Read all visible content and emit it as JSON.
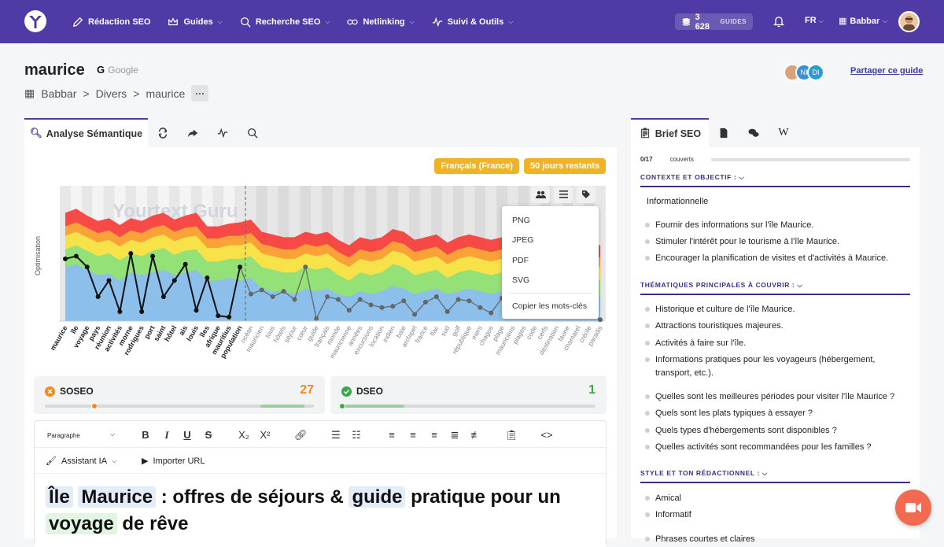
{
  "nav": {
    "items": [
      {
        "label": "Rédaction SEO",
        "caret": false
      },
      {
        "label": "Guides",
        "caret": true
      },
      {
        "label": "Recherche SEO",
        "caret": true
      },
      {
        "label": "Netlinking",
        "caret": true
      },
      {
        "label": "Suivi & Outils",
        "caret": true
      }
    ],
    "credits_value": "3 628",
    "credits_unit": "GUIDES",
    "lang": "FR",
    "account": "Babbar"
  },
  "header": {
    "title": "maurice",
    "engine": "Google",
    "engine_letter": "G",
    "breadcrumb": [
      "Babbar",
      "Divers",
      "maurice"
    ],
    "more": "···",
    "share": "Partager ce guide",
    "collaborators": [
      "NI",
      "DI"
    ]
  },
  "left": {
    "tab_active": "Analyse Sémantique",
    "badges": [
      "Français (France)",
      "50 jours restants"
    ]
  },
  "chart_data": {
    "type": "area",
    "title": "",
    "ylabel": "Optimisation",
    "watermark": "Yourtext.Guru",
    "categories": [
      "maurice",
      "île",
      "voyage",
      "pays",
      "réunion",
      "activités",
      "morne",
      "rodrigues",
      "port",
      "saint",
      "hôtel",
      "ais",
      "louis",
      "îles",
      "afrique",
      "mauritius",
      "population",
      "océan",
      "mauricien",
      "tous",
      "hôtels",
      "séjour",
      "cœur",
      "guide",
      "français",
      "monde",
      "mauricienne",
      "années",
      "excursions",
      "location",
      "indien",
      "baie",
      "archipel",
      "france",
      "flac",
      "sud",
      "golf",
      "république",
      "mers",
      "chagos",
      "plage",
      "mauriciens",
      "plages",
      "code",
      "cerfs",
      "destination",
      "faune",
      "chamarel",
      "créole",
      "paradis"
    ],
    "ylim": [
      0,
      100
    ],
    "split_index": 16,
    "series": [
      {
        "values": [
          46,
          48,
          40,
          18,
          30,
          7,
          50,
          7,
          48,
          18,
          30,
          42,
          8,
          32,
          4,
          3,
          40,
          20,
          23,
          18,
          22,
          16,
          40,
          2,
          18,
          16,
          8,
          16,
          12,
          10,
          11,
          15,
          5,
          14,
          18,
          7,
          16,
          15,
          10,
          6,
          17,
          6,
          18,
          8,
          12,
          10,
          5,
          14,
          8,
          1
        ]
      }
    ],
    "bands": {
      "blue": [
        40,
        42,
        38,
        34,
        35,
        30,
        36,
        34,
        36,
        38,
        34,
        36,
        38,
        30,
        30,
        32,
        30,
        32,
        24,
        22,
        22,
        20,
        24,
        22,
        24,
        20,
        18,
        22,
        20,
        22,
        26,
        24,
        20,
        22,
        24,
        20,
        22,
        24,
        22,
        20,
        22,
        24,
        26,
        22,
        22,
        22,
        22,
        22,
        20,
        18
      ],
      "green": [
        53,
        56,
        52,
        48,
        50,
        45,
        50,
        48,
        52,
        54,
        49,
        52,
        53,
        44,
        44,
        46,
        46,
        48,
        40,
        38,
        36,
        36,
        40,
        38,
        40,
        34,
        30,
        36,
        34,
        36,
        42,
        40,
        34,
        36,
        38,
        32,
        36,
        38,
        36,
        34,
        36,
        38,
        40,
        36,
        36,
        36,
        34,
        36,
        32,
        30
      ],
      "yellow": [
        63,
        66,
        62,
        58,
        60,
        55,
        60,
        58,
        62,
        64,
        59,
        62,
        63,
        54,
        54,
        56,
        56,
        58,
        50,
        48,
        46,
        46,
        50,
        48,
        50,
        44,
        40,
        46,
        44,
        46,
        52,
        50,
        44,
        46,
        48,
        42,
        46,
        48,
        46,
        44,
        46,
        48,
        50,
        46,
        46,
        46,
        44,
        46,
        42,
        40
      ],
      "orange": [
        70,
        73,
        69,
        65,
        67,
        62,
        67,
        65,
        69,
        71,
        66,
        69,
        70,
        61,
        61,
        63,
        63,
        65,
        57,
        55,
        53,
        53,
        57,
        55,
        57,
        51,
        47,
        53,
        51,
        53,
        59,
        57,
        51,
        53,
        55,
        49,
        53,
        55,
        53,
        51,
        53,
        55,
        57,
        53,
        53,
        53,
        51,
        53,
        49,
        47
      ],
      "red": [
        80,
        83,
        78,
        74,
        76,
        71,
        76,
        74,
        78,
        80,
        75,
        78,
        80,
        70,
        70,
        72,
        73,
        75,
        66,
        64,
        62,
        62,
        66,
        64,
        66,
        60,
        56,
        62,
        60,
        62,
        68,
        66,
        60,
        62,
        64,
        58,
        62,
        64,
        62,
        60,
        62,
        64,
        66,
        62,
        62,
        62,
        60,
        62,
        58,
        56
      ]
    },
    "colors": {
      "blue": "#8bbdf0",
      "green": "#8ee07a",
      "yellow": "#f8e64a",
      "orange": "#f9a738",
      "red": "#f8413e",
      "line": "#111111"
    }
  },
  "export_menu": [
    "PNG",
    "JPEG",
    "PDF",
    "SVG",
    "Copier les mots-clés"
  ],
  "scores": [
    {
      "label": "SOSEO",
      "value": "27",
      "color": "#f08a1c",
      "progress": 0.18
    },
    {
      "label": "DSEO",
      "value": "1",
      "color": "#3aa64a",
      "progress": 0.0
    }
  ],
  "toolbar": {
    "paragraph": "Paragraphe",
    "assistant": "Assistant IA",
    "import": "Importer URL"
  },
  "content": {
    "line1_parts": [
      "Île",
      "Maurice",
      " : offres de séjours & ",
      "guide",
      " pratique pour un"
    ],
    "line2_parts": [
      "voyage",
      " de rêve"
    ]
  },
  "right": {
    "tab_active": "Brief SEO",
    "progress_label": "0/17",
    "progress_suffix": "couverts",
    "section1": "CONTEXTE ET OBJECTIF :",
    "intent": "Informationnelle",
    "objectives": [
      "Fournir des informations sur l'île Maurice.",
      "Stimuler l'intérêt pour le tourisme à l'île Maurice.",
      "Encourager la planification de visites et d'activités à Maurice."
    ],
    "section2": "THÉMATIQUES PRINCIPALES À COUVRIR :",
    "themes": [
      "Historique et culture de l'île Maurice.",
      "Attractions touristiques majeures.",
      "Activités à faire sur l'île.",
      "Informations pratiques pour les voyageurs (hébergement, transport, etc.)."
    ],
    "questions": [
      "Quelles sont les meilleures périodes pour visiter l'île Maurice ?",
      "Quels sont les plats typiques à essayer ?",
      "Quels types d'hébergements sont disponibles ?",
      "Quelles activités sont recommandées pour les familles ?"
    ],
    "section3": "STYLE ET TON RÉDACTIONNEL :",
    "styles": [
      "Amical",
      "Informatif"
    ],
    "style_cut": "Phrases courtes et claires"
  }
}
